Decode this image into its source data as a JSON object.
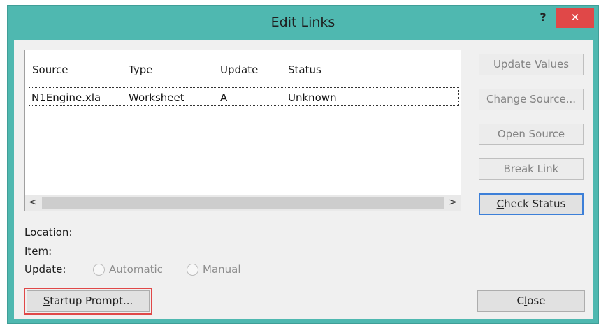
{
  "window": {
    "title": "Edit Links",
    "help_label": "?",
    "close_label": "✕"
  },
  "list": {
    "columns": [
      "Source",
      "Type",
      "Update",
      "Status"
    ],
    "rows": [
      {
        "source": "N1Engine.xla",
        "type": "Worksheet",
        "update": "A",
        "status": "Unknown"
      }
    ],
    "scroll_left_label": "<",
    "scroll_right_label": ">"
  },
  "buttons": {
    "update_values": "Update Values",
    "change_source": "Change Source...",
    "open_source": "Open Source",
    "break_link": "Break Link",
    "check_status_accel": "C",
    "check_status_rest": "heck Status",
    "startup_prompt_accel": "S",
    "startup_prompt_rest": "tartup Prompt...",
    "close_pre": "C",
    "close_accel": "l",
    "close_rest": "ose"
  },
  "info": {
    "location_label": "Location:",
    "item_label": "Item:",
    "update_label": "Update:",
    "automatic_label": "Automatic",
    "manual_label": "Manual"
  },
  "colors": {
    "title_bar": "#4fb8b0",
    "close_button": "#e04848",
    "highlight_box": "#e04848",
    "default_button_border": "#3c7fd8"
  }
}
